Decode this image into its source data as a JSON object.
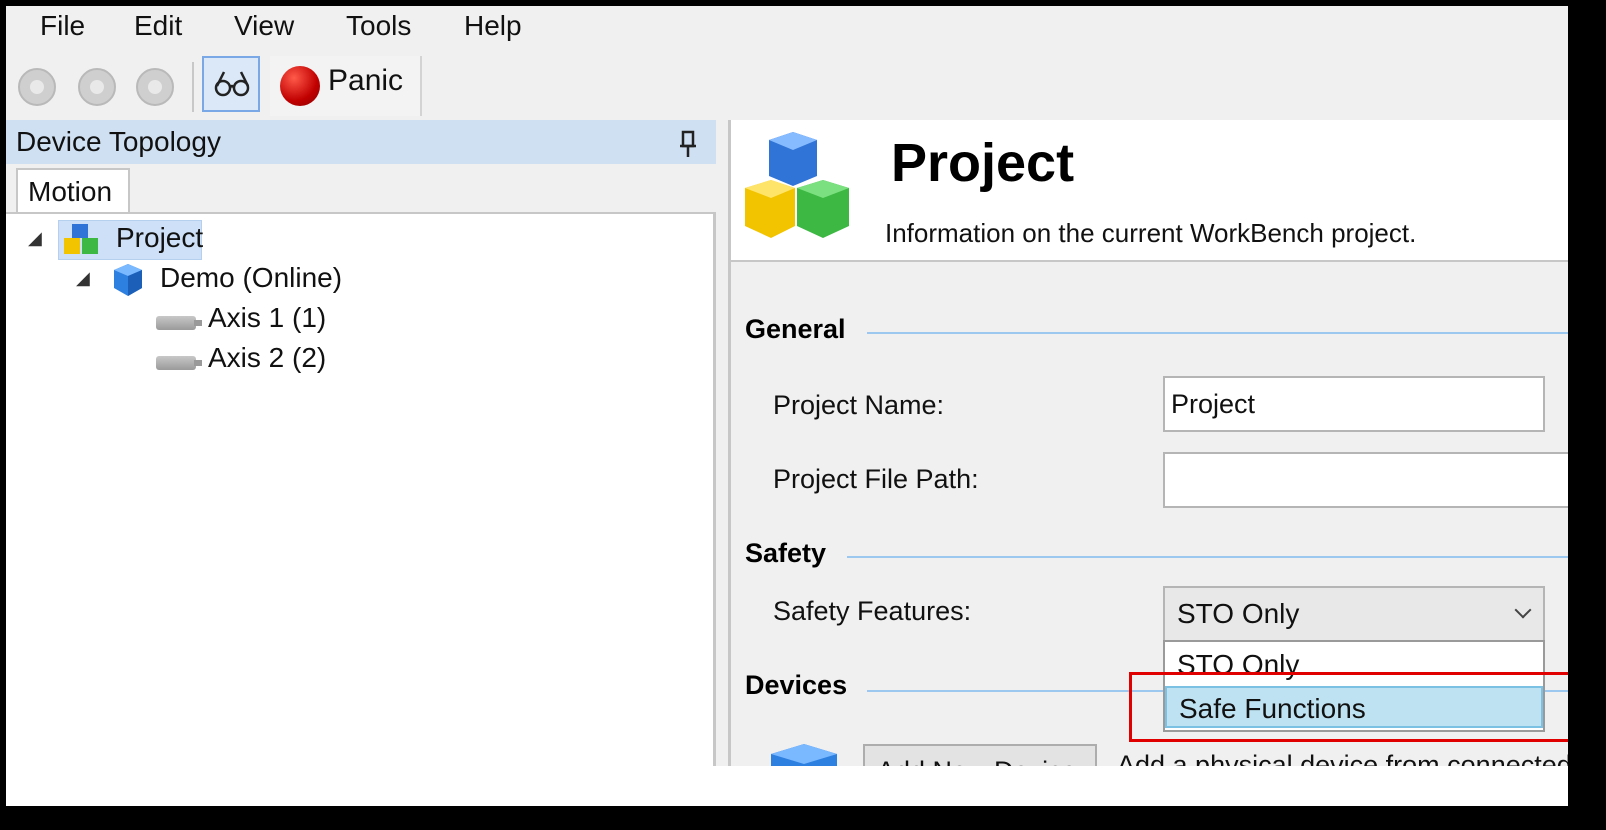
{
  "menu": [
    "File",
    "Edit",
    "View",
    "Tools",
    "Help"
  ],
  "toolbar": {
    "panic_label": "Panic"
  },
  "left_pane": {
    "title": "Device Topology",
    "tab": "Motion",
    "tree": {
      "project": "Project",
      "device": "Demo (Online)",
      "axes": [
        "Axis 1 (1)",
        "Axis 2 (2)"
      ]
    }
  },
  "right_pane": {
    "title": "Project",
    "subtitle": "Information on the current WorkBench project.",
    "general": {
      "heading": "General",
      "project_name_label": "Project Name:",
      "project_name_value": "Project",
      "project_file_path_label": "Project File Path:",
      "project_file_path_value": ""
    },
    "safety": {
      "heading": "Safety",
      "features_label": "Safety Features:",
      "selected": "STO Only",
      "options": [
        "STO Only",
        "Safe Functions"
      ]
    },
    "devices": {
      "heading": "Devices",
      "add_button": "Add New Device",
      "description": "Add a physical device from connected"
    }
  },
  "colors": {
    "accent": "#9cc7ef",
    "highlight": "#bfe2f3",
    "annotation": "#e00000",
    "panic": "#c00000"
  }
}
